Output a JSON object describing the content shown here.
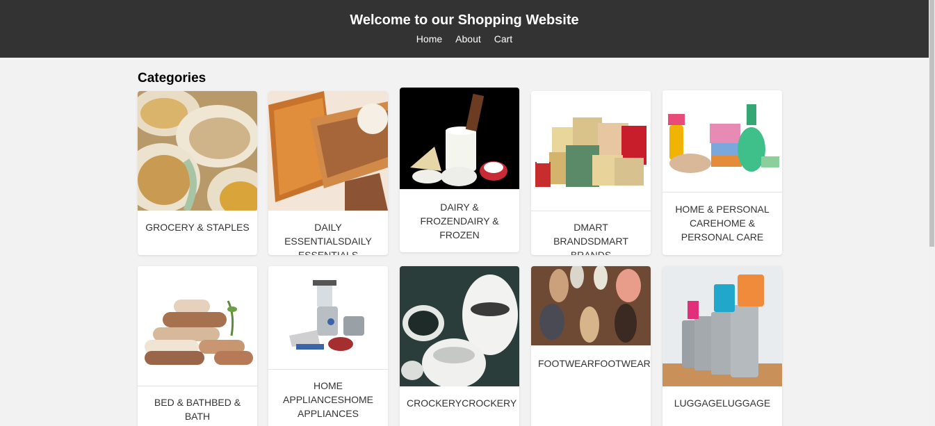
{
  "header": {
    "title": "Welcome to our Shopping Website",
    "nav": [
      "Home",
      "About",
      "Cart"
    ]
  },
  "main": {
    "section_title": "Categories",
    "categories": [
      {
        "label": "GROCERY & STAPLES",
        "image": "grocery-sacks"
      },
      {
        "label": "DAILY ESSENTIALSDAILY ESSENTIALS",
        "image": "biscuits"
      },
      {
        "label": "DAIRY & FROZENDAIRY & FROZEN",
        "image": "dairy-products"
      },
      {
        "label": "DMART BRANDSDMART BRANDS",
        "image": "brand-packets"
      },
      {
        "label": "HOME & PERSONAL CAREHOME & PERSONAL CARE",
        "image": "soaps-and-bottles"
      },
      {
        "label": "BED & BATHBED & BATH",
        "image": "folded-towels"
      },
      {
        "label": "HOME APPLIANCESHOME APPLIANCES",
        "image": "kitchen-appliances"
      },
      {
        "label": "CROCKERYCROCKERY",
        "image": "teapots"
      },
      {
        "label": "FOOTWEARFOOTWEAR",
        "image": "shoes"
      },
      {
        "label": "LUGGAGELUGGAGE",
        "image": "suitcases"
      }
    ]
  }
}
